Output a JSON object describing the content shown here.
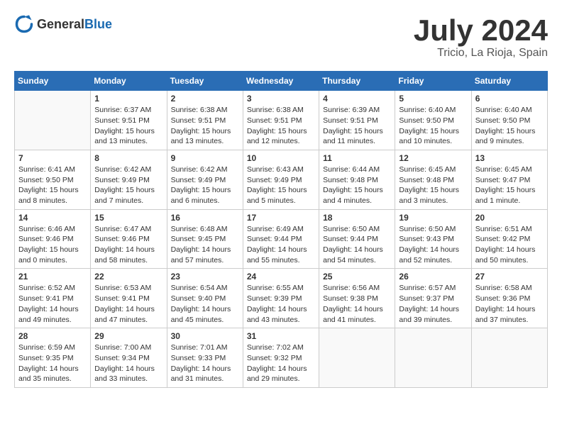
{
  "logo": {
    "text_general": "General",
    "text_blue": "Blue"
  },
  "header": {
    "month": "July 2024",
    "location": "Tricio, La Rioja, Spain"
  },
  "weekdays": [
    "Sunday",
    "Monday",
    "Tuesday",
    "Wednesday",
    "Thursday",
    "Friday",
    "Saturday"
  ],
  "weeks": [
    [
      {
        "day": "",
        "sunrise": "",
        "sunset": "",
        "daylight": ""
      },
      {
        "day": "1",
        "sunrise": "Sunrise: 6:37 AM",
        "sunset": "Sunset: 9:51 PM",
        "daylight": "Daylight: 15 hours and 13 minutes."
      },
      {
        "day": "2",
        "sunrise": "Sunrise: 6:38 AM",
        "sunset": "Sunset: 9:51 PM",
        "daylight": "Daylight: 15 hours and 13 minutes."
      },
      {
        "day": "3",
        "sunrise": "Sunrise: 6:38 AM",
        "sunset": "Sunset: 9:51 PM",
        "daylight": "Daylight: 15 hours and 12 minutes."
      },
      {
        "day": "4",
        "sunrise": "Sunrise: 6:39 AM",
        "sunset": "Sunset: 9:51 PM",
        "daylight": "Daylight: 15 hours and 11 minutes."
      },
      {
        "day": "5",
        "sunrise": "Sunrise: 6:40 AM",
        "sunset": "Sunset: 9:50 PM",
        "daylight": "Daylight: 15 hours and 10 minutes."
      },
      {
        "day": "6",
        "sunrise": "Sunrise: 6:40 AM",
        "sunset": "Sunset: 9:50 PM",
        "daylight": "Daylight: 15 hours and 9 minutes."
      }
    ],
    [
      {
        "day": "7",
        "sunrise": "Sunrise: 6:41 AM",
        "sunset": "Sunset: 9:50 PM",
        "daylight": "Daylight: 15 hours and 8 minutes."
      },
      {
        "day": "8",
        "sunrise": "Sunrise: 6:42 AM",
        "sunset": "Sunset: 9:49 PM",
        "daylight": "Daylight: 15 hours and 7 minutes."
      },
      {
        "day": "9",
        "sunrise": "Sunrise: 6:42 AM",
        "sunset": "Sunset: 9:49 PM",
        "daylight": "Daylight: 15 hours and 6 minutes."
      },
      {
        "day": "10",
        "sunrise": "Sunrise: 6:43 AM",
        "sunset": "Sunset: 9:49 PM",
        "daylight": "Daylight: 15 hours and 5 minutes."
      },
      {
        "day": "11",
        "sunrise": "Sunrise: 6:44 AM",
        "sunset": "Sunset: 9:48 PM",
        "daylight": "Daylight: 15 hours and 4 minutes."
      },
      {
        "day": "12",
        "sunrise": "Sunrise: 6:45 AM",
        "sunset": "Sunset: 9:48 PM",
        "daylight": "Daylight: 15 hours and 3 minutes."
      },
      {
        "day": "13",
        "sunrise": "Sunrise: 6:45 AM",
        "sunset": "Sunset: 9:47 PM",
        "daylight": "Daylight: 15 hours and 1 minute."
      }
    ],
    [
      {
        "day": "14",
        "sunrise": "Sunrise: 6:46 AM",
        "sunset": "Sunset: 9:46 PM",
        "daylight": "Daylight: 15 hours and 0 minutes."
      },
      {
        "day": "15",
        "sunrise": "Sunrise: 6:47 AM",
        "sunset": "Sunset: 9:46 PM",
        "daylight": "Daylight: 14 hours and 58 minutes."
      },
      {
        "day": "16",
        "sunrise": "Sunrise: 6:48 AM",
        "sunset": "Sunset: 9:45 PM",
        "daylight": "Daylight: 14 hours and 57 minutes."
      },
      {
        "day": "17",
        "sunrise": "Sunrise: 6:49 AM",
        "sunset": "Sunset: 9:44 PM",
        "daylight": "Daylight: 14 hours and 55 minutes."
      },
      {
        "day": "18",
        "sunrise": "Sunrise: 6:50 AM",
        "sunset": "Sunset: 9:44 PM",
        "daylight": "Daylight: 14 hours and 54 minutes."
      },
      {
        "day": "19",
        "sunrise": "Sunrise: 6:50 AM",
        "sunset": "Sunset: 9:43 PM",
        "daylight": "Daylight: 14 hours and 52 minutes."
      },
      {
        "day": "20",
        "sunrise": "Sunrise: 6:51 AM",
        "sunset": "Sunset: 9:42 PM",
        "daylight": "Daylight: 14 hours and 50 minutes."
      }
    ],
    [
      {
        "day": "21",
        "sunrise": "Sunrise: 6:52 AM",
        "sunset": "Sunset: 9:41 PM",
        "daylight": "Daylight: 14 hours and 49 minutes."
      },
      {
        "day": "22",
        "sunrise": "Sunrise: 6:53 AM",
        "sunset": "Sunset: 9:41 PM",
        "daylight": "Daylight: 14 hours and 47 minutes."
      },
      {
        "day": "23",
        "sunrise": "Sunrise: 6:54 AM",
        "sunset": "Sunset: 9:40 PM",
        "daylight": "Daylight: 14 hours and 45 minutes."
      },
      {
        "day": "24",
        "sunrise": "Sunrise: 6:55 AM",
        "sunset": "Sunset: 9:39 PM",
        "daylight": "Daylight: 14 hours and 43 minutes."
      },
      {
        "day": "25",
        "sunrise": "Sunrise: 6:56 AM",
        "sunset": "Sunset: 9:38 PM",
        "daylight": "Daylight: 14 hours and 41 minutes."
      },
      {
        "day": "26",
        "sunrise": "Sunrise: 6:57 AM",
        "sunset": "Sunset: 9:37 PM",
        "daylight": "Daylight: 14 hours and 39 minutes."
      },
      {
        "day": "27",
        "sunrise": "Sunrise: 6:58 AM",
        "sunset": "Sunset: 9:36 PM",
        "daylight": "Daylight: 14 hours and 37 minutes."
      }
    ],
    [
      {
        "day": "28",
        "sunrise": "Sunrise: 6:59 AM",
        "sunset": "Sunset: 9:35 PM",
        "daylight": "Daylight: 14 hours and 35 minutes."
      },
      {
        "day": "29",
        "sunrise": "Sunrise: 7:00 AM",
        "sunset": "Sunset: 9:34 PM",
        "daylight": "Daylight: 14 hours and 33 minutes."
      },
      {
        "day": "30",
        "sunrise": "Sunrise: 7:01 AM",
        "sunset": "Sunset: 9:33 PM",
        "daylight": "Daylight: 14 hours and 31 minutes."
      },
      {
        "day": "31",
        "sunrise": "Sunrise: 7:02 AM",
        "sunset": "Sunset: 9:32 PM",
        "daylight": "Daylight: 14 hours and 29 minutes."
      },
      {
        "day": "",
        "sunrise": "",
        "sunset": "",
        "daylight": ""
      },
      {
        "day": "",
        "sunrise": "",
        "sunset": "",
        "daylight": ""
      },
      {
        "day": "",
        "sunrise": "",
        "sunset": "",
        "daylight": ""
      }
    ]
  ]
}
